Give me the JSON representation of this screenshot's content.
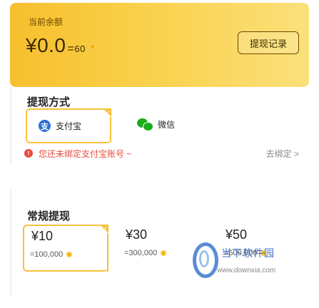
{
  "balance": {
    "label": "当前余额",
    "amount": "¥0.0",
    "separator": "=",
    "coins": "60",
    "coin_icon": "gold-coin-icon"
  },
  "header": {
    "record_label": "提现记录"
  },
  "method": {
    "title": "提现方式",
    "options": [
      {
        "label": "支付宝",
        "icon": "alipay-icon",
        "selected": true
      },
      {
        "label": "微信",
        "icon": "wechat-icon",
        "selected": false
      }
    ],
    "bind_notice": "您还未绑定支付宝账号 ~",
    "bind_link": "去绑定 >"
  },
  "amounts": {
    "title": "常规提现",
    "items": [
      {
        "value": "¥10",
        "coins": "=100,000",
        "selected": true
      },
      {
        "value": "¥30",
        "coins": "=300,000",
        "selected": false
      },
      {
        "value": "¥50",
        "coins": "=500,000",
        "selected": false
      }
    ]
  },
  "watermark": {
    "title": "当下软件园",
    "url": "www.downxia.com"
  },
  "colors": {
    "accent": "#f7c23a",
    "card_start": "#f7bf2e",
    "card_end": "#fbe07a",
    "warning": "#e84c3d",
    "alipay": "#2b6fd6",
    "wechat": "#1aad19"
  }
}
